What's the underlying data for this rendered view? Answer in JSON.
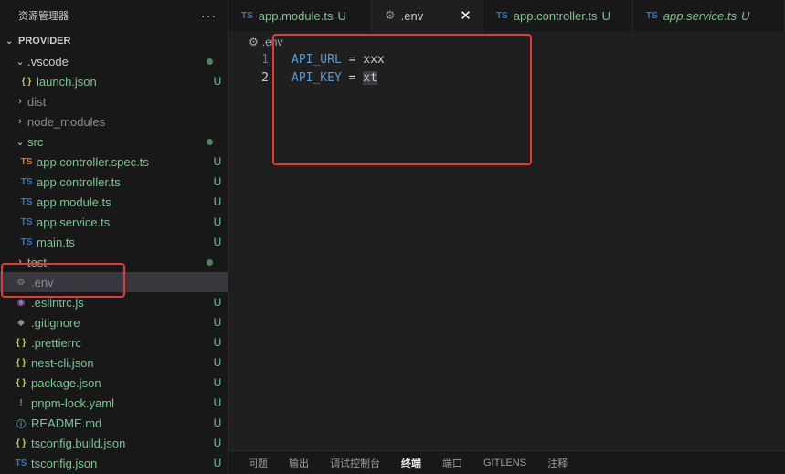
{
  "sidebar": {
    "title": "资源管理器",
    "more": "···",
    "section": "PROVIDER",
    "items": [
      {
        "label": ".vscode",
        "kind": "folder-open",
        "depth": 1,
        "status": "dot"
      },
      {
        "label": "launch.json",
        "icon": "{ }",
        "icon_class": "c-json",
        "depth": 2,
        "name_class": "c-git",
        "status": "U"
      },
      {
        "label": "dist",
        "kind": "folder-closed",
        "depth": 1,
        "name_class": "c-gray"
      },
      {
        "label": "node_modules",
        "kind": "folder-closed",
        "depth": 1,
        "name_class": "c-gray"
      },
      {
        "label": "src",
        "kind": "folder-open",
        "depth": 1,
        "name_class": "c-git",
        "status": "dot"
      },
      {
        "label": "app.controller.spec.ts",
        "icon": "TS",
        "icon_class": "c-tsorange",
        "depth": 2,
        "name_class": "c-git",
        "status": "U"
      },
      {
        "label": "app.controller.ts",
        "icon": "TS",
        "icon_class": "c-ts",
        "depth": 2,
        "name_class": "c-git",
        "status": "U"
      },
      {
        "label": "app.module.ts",
        "icon": "TS",
        "icon_class": "c-ts",
        "depth": 2,
        "name_class": "c-git",
        "status": "U"
      },
      {
        "label": "app.service.ts",
        "icon": "TS",
        "icon_class": "c-ts",
        "depth": 2,
        "name_class": "c-git",
        "status": "U"
      },
      {
        "label": "main.ts",
        "icon": "TS",
        "icon_class": "c-ts",
        "depth": 2,
        "name_class": "c-git",
        "status": "U"
      },
      {
        "label": "test",
        "kind": "folder-closed",
        "depth": 1,
        "name_class": "c-git",
        "status": "dot"
      },
      {
        "label": ".env",
        "icon": "⚙",
        "icon_class": "c-gray",
        "depth": 1,
        "name_class": "c-gray",
        "selected": true
      },
      {
        "label": ".eslintrc.js",
        "icon": "◉",
        "icon_class": "c-eslint",
        "depth": 1,
        "name_class": "c-git",
        "status": "U"
      },
      {
        "label": ".gitignore",
        "icon": "◆",
        "icon_class": "c-gitignore",
        "depth": 1,
        "name_class": "c-git",
        "status": "U"
      },
      {
        "label": ".prettierrc",
        "icon": "{ }",
        "icon_class": "c-json",
        "depth": 1,
        "name_class": "c-git",
        "status": "U"
      },
      {
        "label": "nest-cli.json",
        "icon": "{ }",
        "icon_class": "c-json",
        "depth": 1,
        "name_class": "c-git",
        "status": "U"
      },
      {
        "label": "package.json",
        "icon": "{ }",
        "icon_class": "c-json",
        "depth": 1,
        "name_class": "c-git",
        "status": "U"
      },
      {
        "label": "pnpm-lock.yaml",
        "icon": "!",
        "icon_class": "c-yaml",
        "depth": 1,
        "name_class": "c-git",
        "status": "U"
      },
      {
        "label": "README.md",
        "icon": "ⓘ",
        "icon_class": "c-info",
        "depth": 1,
        "name_class": "c-git",
        "status": "U"
      },
      {
        "label": "tsconfig.build.json",
        "icon": "{ }",
        "icon_class": "c-json",
        "depth": 1,
        "name_class": "c-git",
        "status": "U"
      },
      {
        "label": "tsconfig.json",
        "icon": "TS",
        "icon_class": "c-ts",
        "depth": 1,
        "name_class": "c-git",
        "status": "U"
      }
    ]
  },
  "tabs": [
    {
      "label": "app.module.ts",
      "icon": "TS",
      "status": "U"
    },
    {
      "label": ".env",
      "icon": "gear",
      "active": true,
      "close": "✕"
    },
    {
      "label": "app.controller.ts",
      "icon": "TS",
      "status": "U"
    },
    {
      "label": "app.service.ts",
      "icon": "TS",
      "status": "U",
      "italic": true
    }
  ],
  "breadcrumb": {
    "file": ".env"
  },
  "editor": {
    "lines": [
      {
        "num": "1",
        "key": "API_URL",
        "op": " = ",
        "value": "xxx"
      },
      {
        "num": "2",
        "key": "API_KEY",
        "op": " = ",
        "value": "xt"
      }
    ]
  },
  "panel": {
    "tabs": [
      "问题",
      "输出",
      "调试控制台",
      "终端",
      "端口",
      "GITLENS",
      "注释"
    ],
    "active": "终端"
  },
  "colors": {
    "highlight": "#e53935",
    "git_untracked": "#73c991",
    "accent": "#569cd6"
  }
}
